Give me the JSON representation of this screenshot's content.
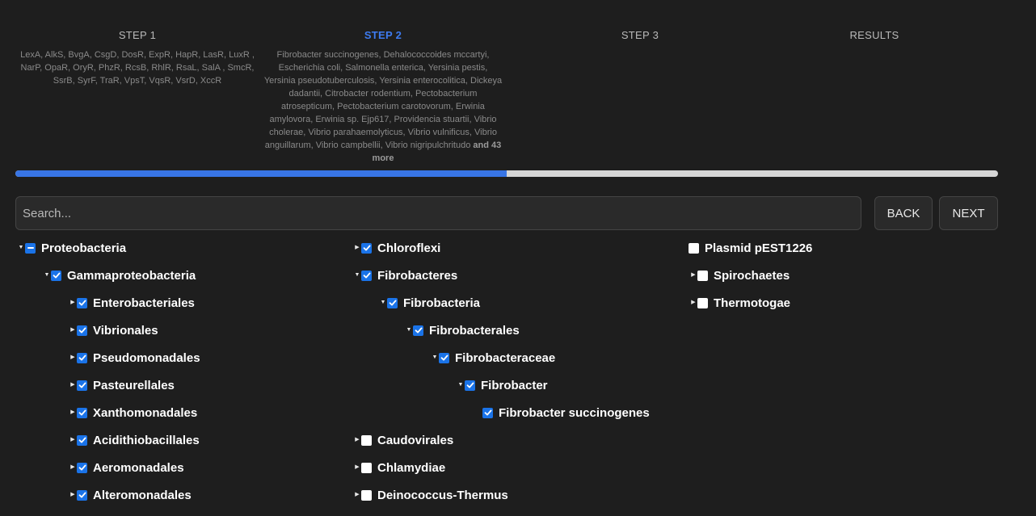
{
  "steps": [
    {
      "title": "STEP 1",
      "desc": "LexA, AlkS, BvgA, CsgD, DosR, ExpR, HapR, LasR, LuxR , NarP, OpaR, OryR, PhzR, RcsB, RhlR, RsaL, SalA , SmcR, SsrB, SyrF, TraR, VpsT, VqsR, VsrD, XccR",
      "more": ""
    },
    {
      "title": "STEP 2",
      "desc": "Fibrobacter succinogenes, Dehalococcoides mccartyi, Escherichia coli, Salmonella enterica, Yersinia pestis, Yersinia pseudotuberculosis, Yersinia enterocolitica, Dickeya dadantii, Citrobacter rodentium, Pectobacterium atrosepticum, Pectobacterium carotovorum, Erwinia amylovora, Erwinia sp. Ejp617, Providencia stuartii, Vibrio cholerae, Vibrio parahaemolyticus, Vibrio vulnificus, Vibrio anguillarum, Vibrio campbellii, Vibrio nigripulchritudo",
      "more": "and 43 more"
    },
    {
      "title": "STEP 3",
      "desc": "",
      "more": ""
    },
    {
      "title": "RESULTS",
      "desc": "",
      "more": ""
    }
  ],
  "active_step": 1,
  "progress": 0.5,
  "search": {
    "placeholder": "Search..."
  },
  "buttons": {
    "back": "BACK",
    "next": "NEXT"
  },
  "tree": {
    "col1": [
      {
        "label": "Proteobacteria",
        "state": "indeterminate",
        "caret": "down"
      },
      {
        "label": "Gammaproteobacteria",
        "state": "checked",
        "caret": "down"
      },
      {
        "label": "Enterobacteriales",
        "state": "checked",
        "caret": "right"
      },
      {
        "label": "Vibrionales",
        "state": "checked",
        "caret": "right"
      },
      {
        "label": "Pseudomonadales",
        "state": "checked",
        "caret": "right"
      },
      {
        "label": "Pasteurellales",
        "state": "checked",
        "caret": "right"
      },
      {
        "label": "Xanthomonadales",
        "state": "checked",
        "caret": "right"
      },
      {
        "label": "Acidithiobacillales",
        "state": "checked",
        "caret": "right"
      },
      {
        "label": "Aeromonadales",
        "state": "checked",
        "caret": "right"
      },
      {
        "label": "Alteromonadales",
        "state": "checked",
        "caret": "right"
      }
    ],
    "col2": [
      {
        "label": "Chloroflexi",
        "state": "checked",
        "caret": "right"
      },
      {
        "label": "Fibrobacteres",
        "state": "checked",
        "caret": "down"
      },
      {
        "label": "Fibrobacteria",
        "state": "checked",
        "caret": "down"
      },
      {
        "label": "Fibrobacterales",
        "state": "checked",
        "caret": "down"
      },
      {
        "label": "Fibrobacteraceae",
        "state": "checked",
        "caret": "down"
      },
      {
        "label": "Fibrobacter",
        "state": "checked",
        "caret": "down"
      },
      {
        "label": "Fibrobacter succinogenes",
        "state": "checked",
        "caret": "none"
      },
      {
        "label": "Caudovirales",
        "state": "unchecked",
        "caret": "right"
      },
      {
        "label": "Chlamydiae",
        "state": "unchecked",
        "caret": "right"
      },
      {
        "label": "Deinococcus-Thermus",
        "state": "unchecked",
        "caret": "right"
      }
    ],
    "col3": [
      {
        "label": "Plasmid pEST1226",
        "state": "unchecked",
        "caret": "none"
      },
      {
        "label": "Spirochaetes",
        "state": "unchecked",
        "caret": "right"
      },
      {
        "label": "Thermotogae",
        "state": "unchecked",
        "caret": "right"
      }
    ]
  }
}
